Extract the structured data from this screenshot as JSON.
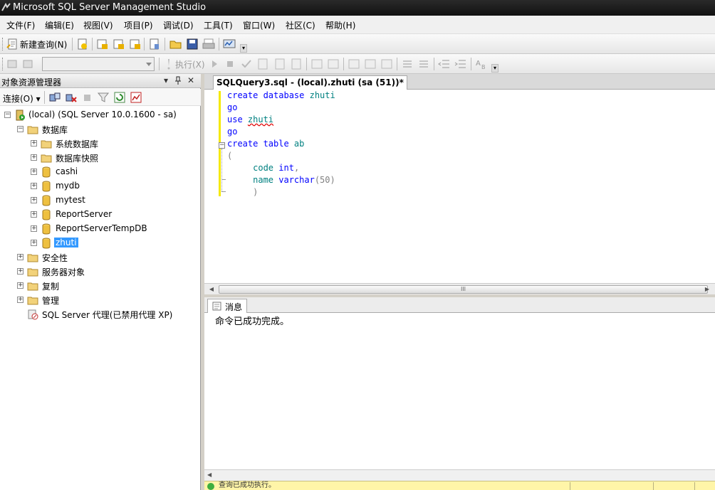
{
  "window": {
    "title": "Microsoft SQL Server Management Studio"
  },
  "menu": [
    "文件(F)",
    "编辑(E)",
    "视图(V)",
    "项目(P)",
    "调试(D)",
    "工具(T)",
    "窗口(W)",
    "社区(C)",
    "帮助(H)"
  ],
  "toolbar": {
    "new_query_label": "新建查询(N)",
    "execute_label": "执行(X)",
    "database_select_value": ""
  },
  "object_explorer": {
    "title": "对象资源管理器",
    "connect_label": "连接(O)",
    "server_node": "(local) (SQL Server 10.0.1600 - sa)",
    "databases_folder": "数据库",
    "system_databases": "系统数据库",
    "snapshots": "数据库快照",
    "databases": [
      "cashi",
      "mydb",
      "mytest",
      "ReportServer",
      "ReportServerTempDB",
      "zhuti"
    ],
    "selected_database": "zhuti",
    "security": "安全性",
    "server_objects": "服务器对象",
    "replication": "复制",
    "management": "管理",
    "agent": "SQL Server 代理(已禁用代理 XP)"
  },
  "editor": {
    "tab_title": "SQLQuery3.sql - (local).zhuti (sa (51))*",
    "lines": [
      {
        "kw": "create database ",
        "id": "zhuti"
      },
      {
        "kw": "go"
      },
      {
        "kw": "use ",
        "id": "zhuti"
      },
      {
        "kw": "go"
      },
      {
        "kw": "create table ",
        "id": "ab"
      },
      {
        "op": "("
      },
      {
        "indent": "     ",
        "id": "code",
        "kw2": " int",
        "op": ","
      },
      {
        "indent": "     ",
        "id": "name",
        "kw2": " varchar",
        "op": "(50)"
      },
      {
        "indent": "     ",
        "op": ")"
      }
    ]
  },
  "results": {
    "tab_label": "消息",
    "message": "命令已成功完成。"
  },
  "status": {
    "text": "查询已成功执行。"
  },
  "scroll": {
    "thumb_grip": "III"
  }
}
